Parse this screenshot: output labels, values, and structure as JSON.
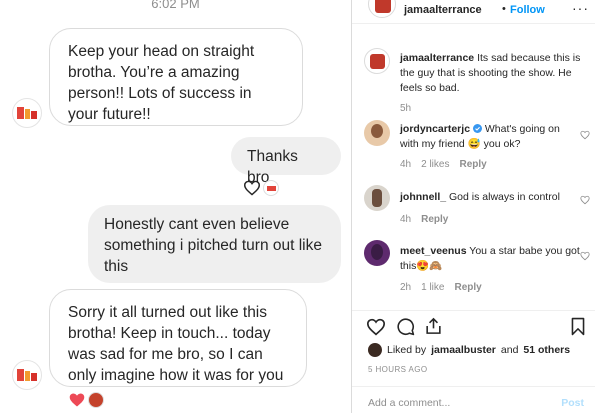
{
  "dm": {
    "time": "6:02 PM",
    "messages": [
      {
        "side": "in",
        "text": "Keep your head on straight brotha. You’re a amazing person!! Lots of success in your future!!"
      },
      {
        "side": "out",
        "text": "Thanks bro."
      },
      {
        "side": "out",
        "text": "Honestly cant even believe something i pitched turn out like this"
      },
      {
        "side": "in",
        "text": "Sorry it all turned out like this brotha! Keep in touch... today was sad for me bro, so I can only imagine how it was for you"
      }
    ]
  },
  "post": {
    "header": {
      "username": "jamaalterrance",
      "separator": "•",
      "follow_label": "Follow",
      "more_icon": "ellipsis-icon"
    },
    "caption": {
      "username": "jamaalterrance",
      "text": "Its sad because this is the guy that is shooting the show. He feels so bad.",
      "age": "5h"
    },
    "comments": [
      {
        "username": "jordyncarterjc",
        "verified": true,
        "text": "What's going on with my friend 😅 you ok?",
        "age": "4h",
        "likes": "2 likes",
        "reply": "Reply"
      },
      {
        "username": "johnnell_",
        "verified": false,
        "text": "God is always in control",
        "age": "4h",
        "likes": "",
        "reply": "Reply"
      },
      {
        "username": "meet_veenus",
        "verified": false,
        "text": "You a star babe you got this😍🙈",
        "age": "2h",
        "likes": "1 like",
        "reply": "Reply"
      }
    ],
    "likes_text_prefix": "Liked by",
    "likes_user": "jamaalbuster",
    "likes_text_mid": "and",
    "likes_others": "51 others",
    "time_ago": "5 HOURS AGO",
    "add_comment_placeholder": "Add a comment...",
    "post_label": "Post"
  },
  "colors": {
    "follow": "#0095f6",
    "verified": "#3897f0",
    "reaction_heart": "#ed4956",
    "bubble_out": "#efefef"
  }
}
